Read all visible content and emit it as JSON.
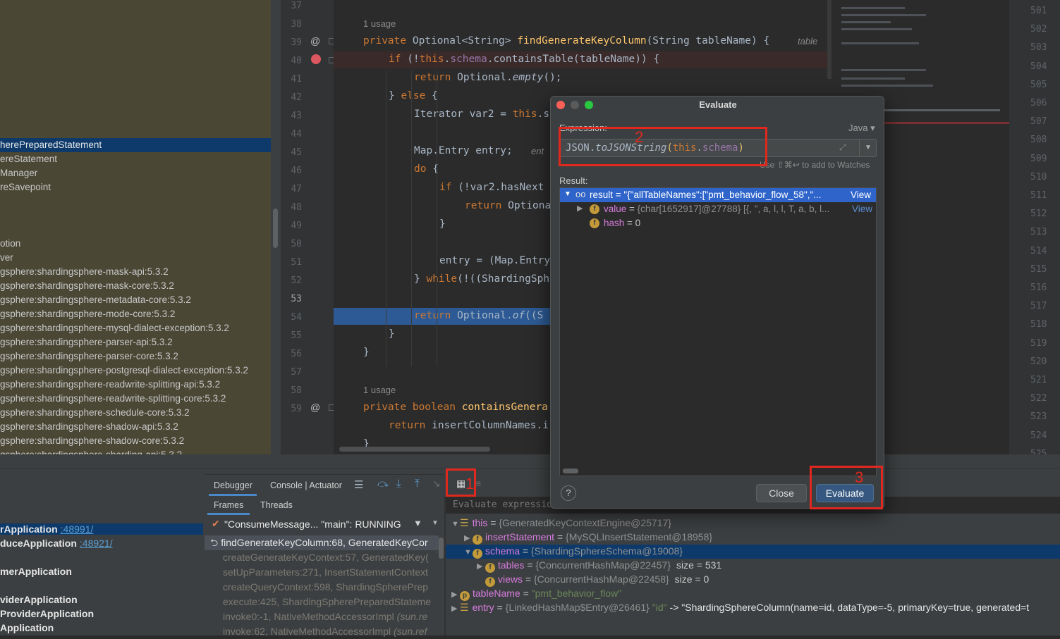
{
  "project_tree": {
    "items": [
      {
        "label": "herePreparedStatement",
        "selected": true
      },
      {
        "label": "ereStatement"
      },
      {
        "label": "Manager"
      },
      {
        "label": "reSavepoint"
      },
      {
        "label": "otion"
      },
      {
        "label": "ver"
      },
      {
        "label": "gsphere:shardingsphere-mask-api:5.3.2"
      },
      {
        "label": "gsphere:shardingsphere-mask-core:5.3.2"
      },
      {
        "label": "gsphere:shardingsphere-metadata-core:5.3.2"
      },
      {
        "label": "gsphere:shardingsphere-mode-core:5.3.2"
      },
      {
        "label": "gsphere:shardingsphere-mysql-dialect-exception:5.3.2"
      },
      {
        "label": "gsphere:shardingsphere-parser-api:5.3.2"
      },
      {
        "label": "gsphere:shardingsphere-parser-core:5.3.2"
      },
      {
        "label": "gsphere:shardingsphere-postgresql-dialect-exception:5.3.2"
      },
      {
        "label": "gsphere:shardingsphere-readwrite-splitting-api:5.3.2"
      },
      {
        "label": "gsphere:shardingsphere-readwrite-splitting-core:5.3.2"
      },
      {
        "label": "gsphere:shardingsphere-schedule-core:5.3.2"
      },
      {
        "label": "gsphere:shardingsphere-shadow-api:5.3.2"
      },
      {
        "label": "gsphere:shardingsphere-shadow-core:5.3.2"
      },
      {
        "label": "gsphere:shardingsphere-sharding-api:5.3.2"
      }
    ]
  },
  "editor": {
    "line_numbers": [
      "37",
      "38",
      "39",
      "40",
      "41",
      "42",
      "43",
      "44",
      "45",
      "46",
      "47",
      "48",
      "49",
      "50",
      "51",
      "52",
      "53",
      "54",
      "55",
      "56",
      "57",
      "58",
      "59"
    ],
    "usage_hint_1": "1 usage",
    "usage_hint_2": "1 usage",
    "param_hint_38": "table",
    "inline_hint_44": "ent",
    "code": {
      "l38_kw": "private ",
      "l38_type": "Optional<String> ",
      "l38_fn": "findGenerateKeyColumn",
      "l38_rest": "(String tableName) {",
      "l39_kw": "if ",
      "l39_a": "(!",
      "l39_this": "this",
      "l39_dot": ".",
      "l39_schema": "schema",
      "l39_rest": ".containsTable(tableName)) {",
      "l40_kw": "return ",
      "l40_a": "Optional.",
      "l40_b": "empty",
      "l40_c": "();",
      "l41_a": "} ",
      "l41_kw": "else",
      "l41_b": " {",
      "l42_a": "Iterator var2 = ",
      "l42_this": "this",
      "l42_b": ".s",
      "l44_a": "Map.Entry entry;",
      "l45_kw": "do",
      "l45_b": " {",
      "l46_kw": "if ",
      "l46_b": "(!var2.hasNext",
      "l47_kw": "return ",
      "l47_b": "Optiona",
      "l48_a": "}",
      "l50_a": "entry = (Map.Entry",
      "l51_a": "} ",
      "l51_kw": "while",
      "l51_b": "(!((ShardingSph",
      "l53_kw": "return ",
      "l53_a": "Optional.",
      "l53_b": "of",
      "l53_c": "((S",
      "l54_a": "}",
      "l55_a": "}",
      "l57_kw": "private boolean ",
      "l57_fn": "containsGenera",
      "l58_kw": "return ",
      "l58_a": "insertColumnNames.i",
      "l59_a": "}"
    }
  },
  "right_line_numbers": [
    "501",
    "502",
    "503",
    "504",
    "505",
    "506",
    "507",
    "508",
    "509",
    "510",
    "511",
    "512",
    "513",
    "514",
    "515",
    "516",
    "517",
    "518",
    "519",
    "520",
    "521",
    "522",
    "523",
    "524",
    "525"
  ],
  "debug": {
    "tabs": {
      "debugger": "Debugger",
      "console": "Console | Actuator"
    },
    "subtabs": {
      "frames": "Frames",
      "threads": "Threads"
    },
    "thread_selector": "\"ConsumeMessage... \"main\": RUNNING",
    "evaluate_placeholder": "Evaluate expressio",
    "frames": [
      {
        "label": "findGenerateKeyColumn:68, GeneratedKeyCor",
        "current": true
      },
      {
        "label": "createGenerateKeyContext:57, GeneratedKey("
      },
      {
        "label": "setUpParameters:271, InsertStatementContext"
      },
      {
        "label": "createQueryContext:598, ShardingSpherePrep"
      },
      {
        "label": "execute:425, ShardingSpherePreparedStateme"
      },
      {
        "label": "invoke0:-1, NativeMethodAccessorImpl ",
        "extra": "(sun.re"
      },
      {
        "label": "invoke:62, NativeMethodAccessorImpl ",
        "extra": "(sun.ref"
      }
    ],
    "apps": [
      {
        "name": "rApplication",
        "port": ":48991/",
        "selected": true
      },
      {
        "name": "duceApplication",
        "port": ":48921/"
      },
      {
        "name": "merApplication",
        "port": ""
      },
      {
        "name": "viderApplication",
        "port": ""
      },
      {
        "name": "ProviderApplication",
        "port": ""
      },
      {
        "name": "Application",
        "port": ""
      }
    ],
    "variables": [
      {
        "name": "this",
        "value": "{GeneratedKeyContextEngine@25717}"
      },
      {
        "name": "insertStatement",
        "value": "{MySQLInsertStatement@18958}"
      },
      {
        "name": "schema",
        "value": "{ShardingSphereSchema@19008}"
      },
      {
        "name": "tables",
        "value": "{ConcurrentHashMap@22457}",
        "extra": "size = 531"
      },
      {
        "name": "views",
        "value": "{ConcurrentHashMap@22458}",
        "extra": "size = 0"
      },
      {
        "name": "tableName",
        "value": "\"pmt_behavior_flow\""
      },
      {
        "name": "entry",
        "value": "{LinkedHashMap$Entry@26461}",
        "extra_a": "\"id\"",
        "extra_b": " -> \"ShardingSphereColumn(name=id, dataType=-5, primaryKey=true, generated=t"
      }
    ]
  },
  "evaluate_dialog": {
    "title": "Evaluate",
    "expression_label": "Expression:",
    "language": "Java",
    "expression": {
      "a": "JSON.",
      "b": "toJSONString",
      "c": "(",
      "d": "this",
      "e": ".",
      "f": "schema",
      "g": ")"
    },
    "watch_hint": "Use ⇧⌘↩ to add to Watches",
    "result_label": "Result:",
    "result_line": "result = \"{\"allTableNames\":[\"pmt_behavior_flow_58\",\"...",
    "result_view": "View",
    "value_line_name": "value",
    "value_line_value": "{char[1652917]@27788} [{, \", a, l, l, T, a, b, l...",
    "value_view": "View",
    "hash_name": "hash",
    "hash_value": "0",
    "close_label": "Close",
    "evaluate_label": "Evaluate",
    "help_label": "?"
  },
  "annotations": {
    "n1": "1",
    "n2": "2",
    "n3": "3"
  },
  "colors": {
    "accent": "#2f65ca",
    "annotation": "#e0281e",
    "breakpoint": "#db5860"
  }
}
